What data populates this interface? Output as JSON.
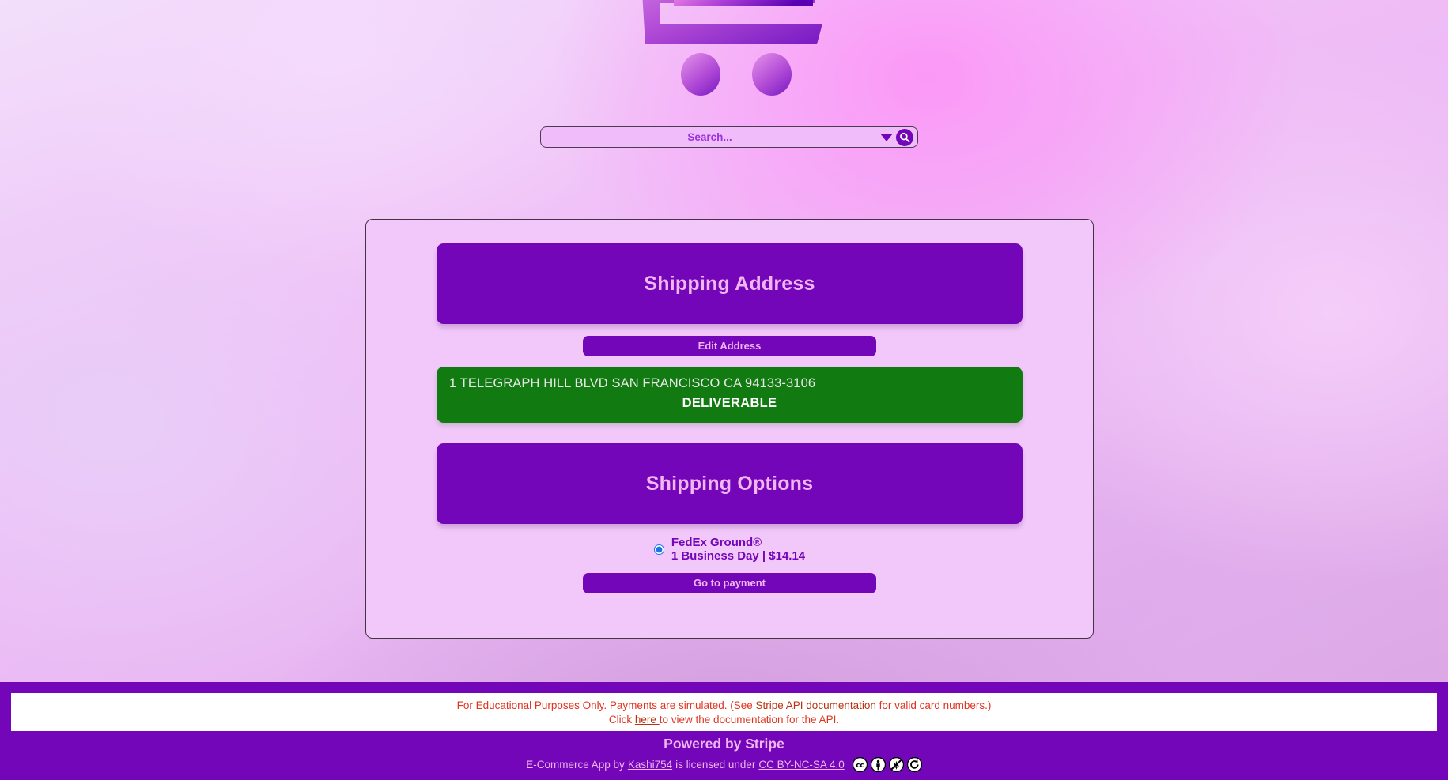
{
  "header": {
    "logo_icon": "shopping-cart-icon",
    "search": {
      "placeholder": "Search...",
      "value": "",
      "filter_icon": "chevron-down-icon",
      "search_icon": "search-icon"
    }
  },
  "checkout": {
    "shipping_address": {
      "banner_title": "Shipping Address",
      "edit_button_label": "Edit Address",
      "address_line": "1 TELEGRAPH HILL BLVD SAN FRANCISCO CA 94133-3106",
      "status_label": "DELIVERABLE",
      "status_color": "#117a11"
    },
    "shipping_options": {
      "banner_title": "Shipping Options",
      "options": [
        {
          "carrier": "FedEx Ground®",
          "detail": "1 Business Day | $14.14",
          "selected": true
        }
      ],
      "continue_button_label": "Go to payment"
    }
  },
  "footer": {
    "notice": {
      "line1_part1": "For Educational Purposes Only. Payments are simulated. (See ",
      "line1_link": "Stripe API documentation",
      "line1_part2": " for valid card numbers.)",
      "line2_part1": "Click ",
      "line2_link": "here ",
      "line2_part2": "to view the documentation for the API."
    },
    "powered_by": "Powered by Stripe",
    "license": {
      "prefix": "E-Commerce App by ",
      "author": "Kashi754",
      "middle": " is licensed under ",
      "license_name": "CC BY-NC-SA 4.0 ",
      "icons": [
        "cc-icon",
        "cc-by-icon",
        "cc-nc-icon",
        "cc-sa-icon"
      ]
    }
  },
  "theme": {
    "primary_purple": "#7206b8",
    "light_pink_text": "#f0b5f2",
    "card_bg": "#f2c8fa",
    "green": "#117a11",
    "notice_red": "#e0341f"
  }
}
